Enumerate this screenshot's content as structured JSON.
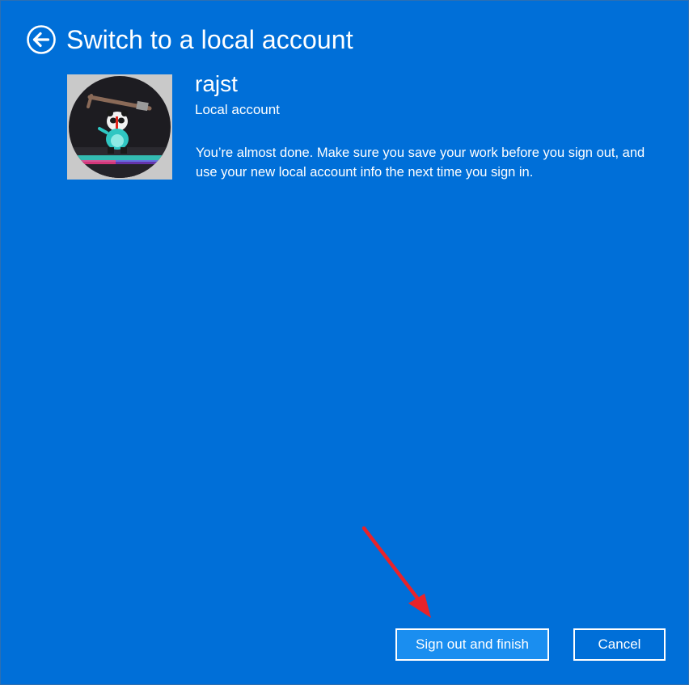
{
  "header": {
    "title": "Switch to a local account",
    "back_icon": "back-arrow-circle-icon"
  },
  "account": {
    "avatar_icon": "user-avatar-photo",
    "username": "rajst",
    "type": "Local account"
  },
  "message": "You’re almost done. Make sure you save your work before you sign out, and use your new local account info the next time you sign in.",
  "buttons": {
    "primary_label": "Sign out and finish",
    "secondary_label": "Cancel"
  },
  "colors": {
    "background": "#006fd8",
    "primary_button": "#1a8ef0",
    "text": "#ffffff",
    "annotation_arrow": "#e8232a"
  }
}
